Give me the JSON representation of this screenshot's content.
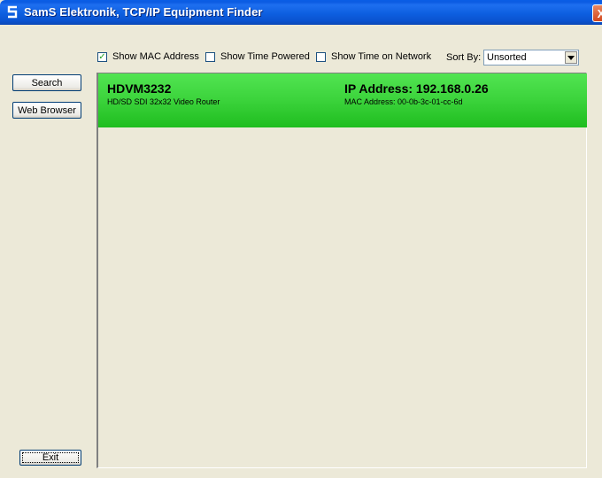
{
  "window": {
    "title": "SamS Elektronik, TCP/IP Equipment Finder",
    "close_label": "X"
  },
  "toolbar": {
    "show_mac": {
      "label": "Show MAC Address",
      "checked": true
    },
    "show_time_powered": {
      "label": "Show Time Powered",
      "checked": false
    },
    "show_time_network": {
      "label": "Show Time on Network",
      "checked": false
    },
    "sort_by_label": "Sort By:",
    "sort_by_value": "Unsorted"
  },
  "buttons": {
    "search": "Search",
    "web_browser": "Web Browser",
    "exit": "Exit"
  },
  "devices": [
    {
      "name": "HDVM3232",
      "description": "HD/SD SDI 32x32 Video Router",
      "ip": "IP Address: 192.168.0.26",
      "mac": "MAC Address: 00-0b-3c-01-cc-6d"
    }
  ],
  "colors": {
    "title_bar": "#0a5ee6",
    "window_bg": "#ece9d8",
    "device_row": "#3ed23e"
  }
}
